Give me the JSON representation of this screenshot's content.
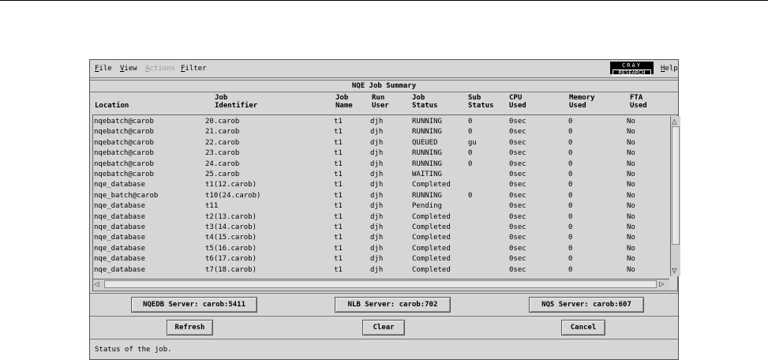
{
  "menubar": {
    "file": "File",
    "view": "View",
    "actions": "Actions",
    "filter": "Filter",
    "logo_line1": "CRAY",
    "logo_line2": "RESEARCH",
    "help": "Help"
  },
  "summary_title": "NQE Job Summary",
  "columns": {
    "location": "Location",
    "job_identifier": [
      "Job",
      "Identifier"
    ],
    "job_name": [
      "Job",
      "Name"
    ],
    "run_user": [
      "Run",
      "User"
    ],
    "job_status": [
      "Job",
      "Status"
    ],
    "sub_status": [
      "Sub",
      "Status"
    ],
    "cpu_used": [
      "CPU",
      "Used"
    ],
    "memory_used": [
      "Memory",
      "Used"
    ],
    "fta_used": [
      "FTA",
      "Used"
    ]
  },
  "jobs": [
    {
      "location": "nqebatch@carob",
      "id": "20.carob",
      "name": "t1",
      "user": "djh",
      "status": "RUNNING",
      "sub": "0",
      "cpu": "0sec",
      "mem": "0",
      "fta": "No"
    },
    {
      "location": "nqebatch@carob",
      "id": "21.carob",
      "name": "t1",
      "user": "djh",
      "status": "RUNNING",
      "sub": "0",
      "cpu": "0sec",
      "mem": "0",
      "fta": "No"
    },
    {
      "location": "nqebatch@carob",
      "id": "22.carob",
      "name": "t1",
      "user": "djh",
      "status": "QUEUED",
      "sub": "gu",
      "cpu": "0sec",
      "mem": "0",
      "fta": "No"
    },
    {
      "location": "nqebatch@carob",
      "id": "23.carob",
      "name": "t1",
      "user": "djh",
      "status": "RUNNING",
      "sub": "0",
      "cpu": "0sec",
      "mem": "0",
      "fta": "No"
    },
    {
      "location": "nqebatch@carob",
      "id": "24.carob",
      "name": "t1",
      "user": "djh",
      "status": "RUNNING",
      "sub": "0",
      "cpu": "0sec",
      "mem": "0",
      "fta": "No"
    },
    {
      "location": "nqebatch@carob",
      "id": "25.carob",
      "name": "t1",
      "user": "djh",
      "status": "WAITING",
      "sub": "",
      "cpu": "0sec",
      "mem": "0",
      "fta": "No"
    },
    {
      "location": "nqe_database",
      "id": "t1(12.carob)",
      "name": "t1",
      "user": "djh",
      "status": "Completed",
      "sub": "",
      "cpu": "0sec",
      "mem": "0",
      "fta": "No"
    },
    {
      "location": "nqe_batch@carob",
      "id": "t10(24.carob)",
      "name": "t1",
      "user": "djh",
      "status": "RUNNING",
      "sub": "0",
      "cpu": "0sec",
      "mem": "0",
      "fta": "No"
    },
    {
      "location": "nqe_database",
      "id": "t11",
      "name": "t1",
      "user": "djh",
      "status": "Pending",
      "sub": "",
      "cpu": "0sec",
      "mem": "0",
      "fta": "No"
    },
    {
      "location": "nqe_database",
      "id": "t2(13.carob)",
      "name": "t1",
      "user": "djh",
      "status": "Completed",
      "sub": "",
      "cpu": "0sec",
      "mem": "0",
      "fta": "No"
    },
    {
      "location": "nqe_database",
      "id": "t3(14.carob)",
      "name": "t1",
      "user": "djh",
      "status": "Completed",
      "sub": "",
      "cpu": "0sec",
      "mem": "0",
      "fta": "No"
    },
    {
      "location": "nqe_database",
      "id": "t4(15.carob)",
      "name": "t1",
      "user": "djh",
      "status": "Completed",
      "sub": "",
      "cpu": "0sec",
      "mem": "0",
      "fta": "No"
    },
    {
      "location": "nqe_database",
      "id": "t5(16.carob)",
      "name": "t1",
      "user": "djh",
      "status": "Completed",
      "sub": "",
      "cpu": "0sec",
      "mem": "0",
      "fta": "No"
    },
    {
      "location": "nqe_database",
      "id": "t6(17.carob)",
      "name": "t1",
      "user": "djh",
      "status": "Completed",
      "sub": "",
      "cpu": "0sec",
      "mem": "0",
      "fta": "No"
    },
    {
      "location": "nqe_database",
      "id": "t7(18.carob)",
      "name": "t1",
      "user": "djh",
      "status": "Completed",
      "sub": "",
      "cpu": "0sec",
      "mem": "0",
      "fta": "No"
    }
  ],
  "servers": {
    "nqedb": "NQEDB Server: carob:5411",
    "nlb": "NLB Server: carob:702",
    "nqs": "NQS Server: carob:607"
  },
  "buttons": {
    "refresh": "Refresh",
    "clear": "Clear",
    "cancel": "Cancel"
  },
  "status_text": "Status of the job."
}
